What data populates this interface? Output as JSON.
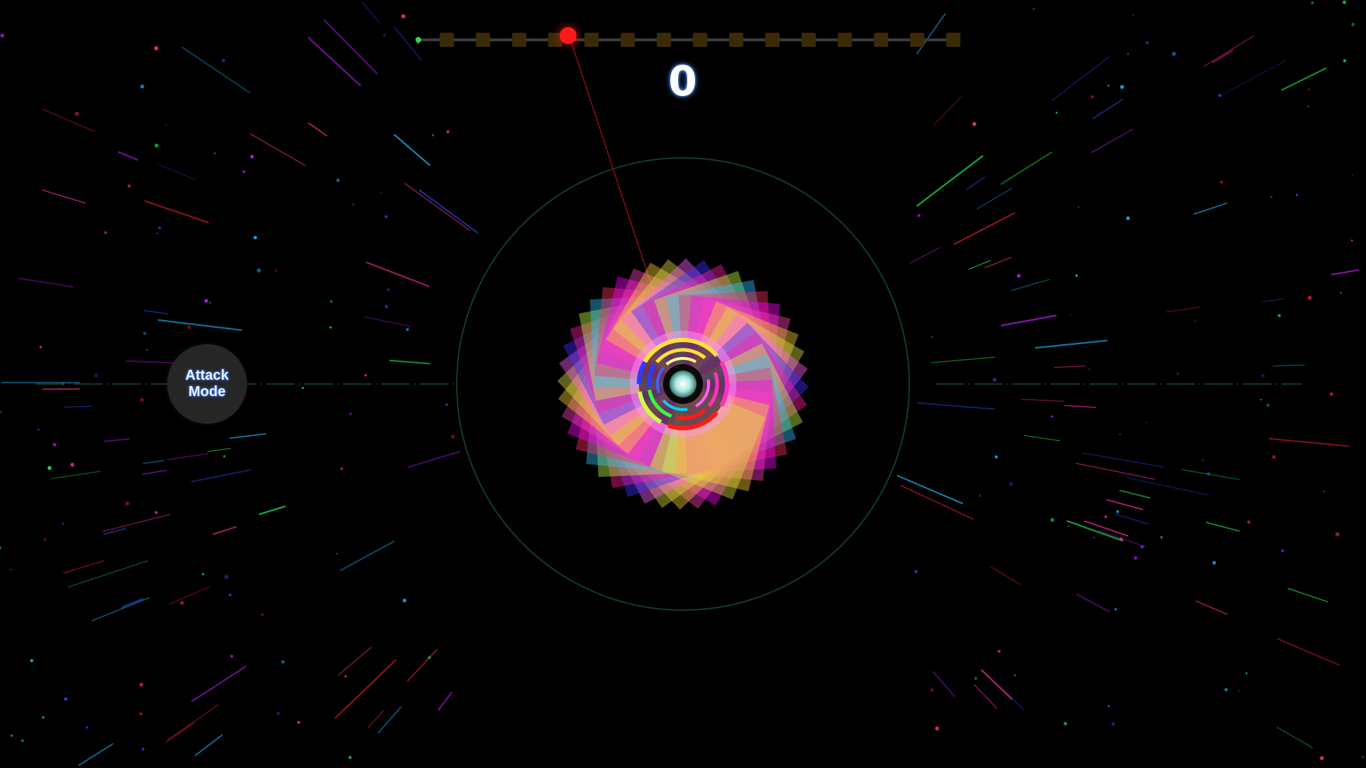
{
  "hud": {
    "score": "0",
    "attack_button_label_line1": "Attack",
    "attack_button_label_line2": "Mode"
  },
  "progress_track": {
    "checkpoint_count": 15,
    "current_position": 0.28,
    "start_marker_color": "#3fd14a",
    "checkpoint_color": "#3a2a08",
    "marker_color": "#ff1a1a",
    "track_color": "#3c3c3c"
  },
  "palette": {
    "background": "#000000",
    "arena_ring": "#123a2a",
    "core": "#a8e8e0",
    "shield_colors": [
      "#ff1a1a",
      "#2a3cff",
      "#00d0ff",
      "#ffe040",
      "#ff30c0",
      "#30ff40"
    ]
  }
}
